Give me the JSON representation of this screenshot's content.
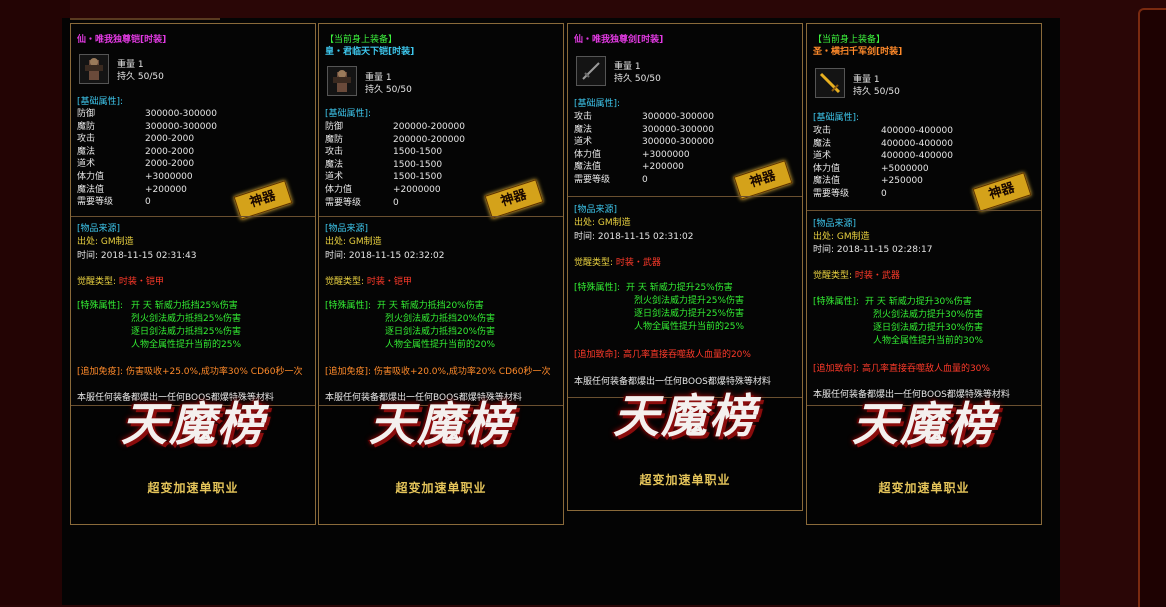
{
  "cards": [
    {
      "header": "",
      "name": "仙・唯我独尊铠[时装]",
      "name_color": "#e23ae2",
      "icon": "armor-icon",
      "weight": "重量 1",
      "durability": "持久 50/50",
      "base_label": "[基础属性]:",
      "stats": [
        {
          "k": "防御",
          "v": "300000-300000"
        },
        {
          "k": "魔防",
          "v": "300000-300000"
        },
        {
          "k": "攻击",
          "v": "2000-2000"
        },
        {
          "k": "魔法",
          "v": "2000-2000"
        },
        {
          "k": "道术",
          "v": "2000-2000"
        },
        {
          "k": "体力值",
          "v": "+3000000"
        },
        {
          "k": "魔法值",
          "v": "+200000"
        },
        {
          "k": "需要等级",
          "v": "0"
        }
      ],
      "seal": "神器",
      "source_label": "[物品来源]",
      "source_from": "出处: GM制造",
      "source_time": "时间: 2018-11-15 02:31:43",
      "awaken_label": "觉醒类型:",
      "awaken_value": "时装・铠甲",
      "special_label": "[特殊属性]:",
      "special_lines": [
        "开 天 斩威力抵挡25%伤害",
        "烈火剑法威力抵挡25%伤害",
        "逐日剑法威力抵挡25%伤害",
        "人物全属性提升当前的25%"
      ],
      "extra_label": "[追加免疫]:",
      "extra_value": "伤害吸收+25.0%,成功率30% CD60秒一次",
      "footer": "本服任何装备都爆出一任何BOOS都爆特殊等材料",
      "logo_title": "天魔榜",
      "logo_sub": "超变加速单职业"
    },
    {
      "header": "【当前身上装备】",
      "name": "皇・君临天下铠[时装]",
      "name_color": "#3ec8ee",
      "icon": "armor-icon",
      "weight": "重量 1",
      "durability": "持久 50/50",
      "base_label": "[基础属性]:",
      "stats": [
        {
          "k": "防御",
          "v": "200000-200000"
        },
        {
          "k": "魔防",
          "v": "200000-200000"
        },
        {
          "k": "攻击",
          "v": "1500-1500"
        },
        {
          "k": "魔法",
          "v": "1500-1500"
        },
        {
          "k": "道术",
          "v": "1500-1500"
        },
        {
          "k": "体力值",
          "v": "+2000000"
        },
        {
          "k": "需要等级",
          "v": "0"
        }
      ],
      "seal": "神器",
      "source_label": "[物品来源]",
      "source_from": "出处: GM制造",
      "source_time": "时间: 2018-11-15 02:32:02",
      "awaken_label": "觉醒类型:",
      "awaken_value": "时装・铠甲",
      "special_label": "[特殊属性]:",
      "special_lines": [
        "开 天 斩威力抵挡20%伤害",
        "烈火剑法威力抵挡20%伤害",
        "逐日剑法威力抵挡20%伤害",
        "人物全属性提升当前的20%"
      ],
      "extra_label": "[追加免疫]:",
      "extra_value": "伤害吸收+20.0%,成功率20% CD60秒一次",
      "footer": "本服任何装备都爆出一任何BOOS都爆特殊等材料",
      "logo_title": "天魔榜",
      "logo_sub": "超变加速单职业"
    },
    {
      "header": "",
      "name": "仙・唯我独尊剑[时装]",
      "name_color": "#e23ae2",
      "icon": "sword-icon",
      "weight": "重量 1",
      "durability": "持久 50/50",
      "base_label": "[基础属性]:",
      "stats": [
        {
          "k": "攻击",
          "v": "300000-300000"
        },
        {
          "k": "魔法",
          "v": "300000-300000"
        },
        {
          "k": "道术",
          "v": "300000-300000"
        },
        {
          "k": "体力值",
          "v": "+3000000"
        },
        {
          "k": "魔法值",
          "v": "+200000"
        },
        {
          "k": "需要等级",
          "v": "0"
        }
      ],
      "seal": "神器",
      "source_label": "[物品来源]",
      "source_from": "出处: GM制造",
      "source_time": "时间: 2018-11-15 02:31:02",
      "awaken_label": "觉醒类型:",
      "awaken_value": "时装・武器",
      "special_label": "[特殊属性]:",
      "special_lines": [
        "开 天 斩威力提升25%伤害",
        "烈火剑法威力提升25%伤害",
        "逐日剑法威力提升25%伤害",
        "人物全属性提升当前的25%"
      ],
      "extra_label": "[追加致命]:",
      "extra_value": "高几率直接吞噬敌人血量的20%",
      "footer": "本服任何装备都爆出一任何BOOS都爆特殊等材料",
      "logo_title": "天魔榜",
      "logo_sub": "超变加速单职业"
    },
    {
      "header": "【当前身上装备】",
      "name": "圣・横扫千军剑[时装]",
      "name_color": "#ff8a2a",
      "icon": "sword-icon",
      "weight": "重量 1",
      "durability": "持久 50/50",
      "base_label": "[基础属性]:",
      "stats": [
        {
          "k": "攻击",
          "v": "400000-400000"
        },
        {
          "k": "魔法",
          "v": "400000-400000"
        },
        {
          "k": "道术",
          "v": "400000-400000"
        },
        {
          "k": "体力值",
          "v": "+5000000"
        },
        {
          "k": "魔法值",
          "v": "+250000"
        },
        {
          "k": "需要等级",
          "v": "0"
        }
      ],
      "seal": "神器",
      "source_label": "[物品来源]",
      "source_from": "出处: GM制造",
      "source_time": "时间: 2018-11-15 02:28:17",
      "awaken_label": "觉醒类型:",
      "awaken_value": "时装・武器",
      "special_label": "[特殊属性]:",
      "special_lines": [
        "开 天 斩威力提升30%伤害",
        "烈火剑法威力提升30%伤害",
        "逐日剑法威力提升30%伤害",
        "人物全属性提升当前的30%"
      ],
      "extra_label": "[追加致命]:",
      "extra_value": "高几率直接吞噬敌人血量的30%",
      "footer": "本服任何装备都爆出一任何BOOS都爆特殊等材料",
      "logo_title": "天魔榜",
      "logo_sub": "超变加速单职业"
    }
  ]
}
